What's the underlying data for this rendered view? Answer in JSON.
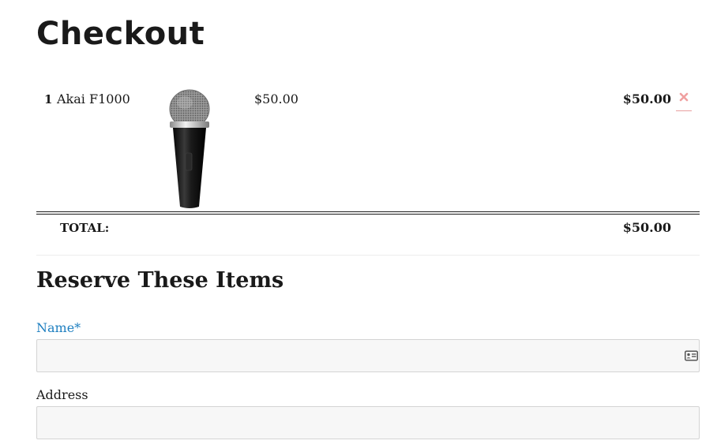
{
  "page": {
    "title": "Checkout"
  },
  "cart": {
    "items": [
      {
        "quantity": "1",
        "name": "Akai F1000",
        "image": "microphone",
        "price": "$50.00",
        "line_total": "$50.00",
        "remove_icon": "close-icon"
      }
    ],
    "total_label": "TOTAL:",
    "total_value": "$50.00"
  },
  "reserve_form": {
    "heading": "Reserve These Items",
    "fields": {
      "name": {
        "label": "Name*",
        "value": "",
        "icon": "contact-card-icon"
      },
      "address": {
        "label": "Address",
        "value": ""
      }
    }
  },
  "colors": {
    "required_label": "#1e7fc0",
    "remove_icon": "#f0a0a0",
    "input_background": "#f7f7f7",
    "text": "#1a1a1a"
  }
}
